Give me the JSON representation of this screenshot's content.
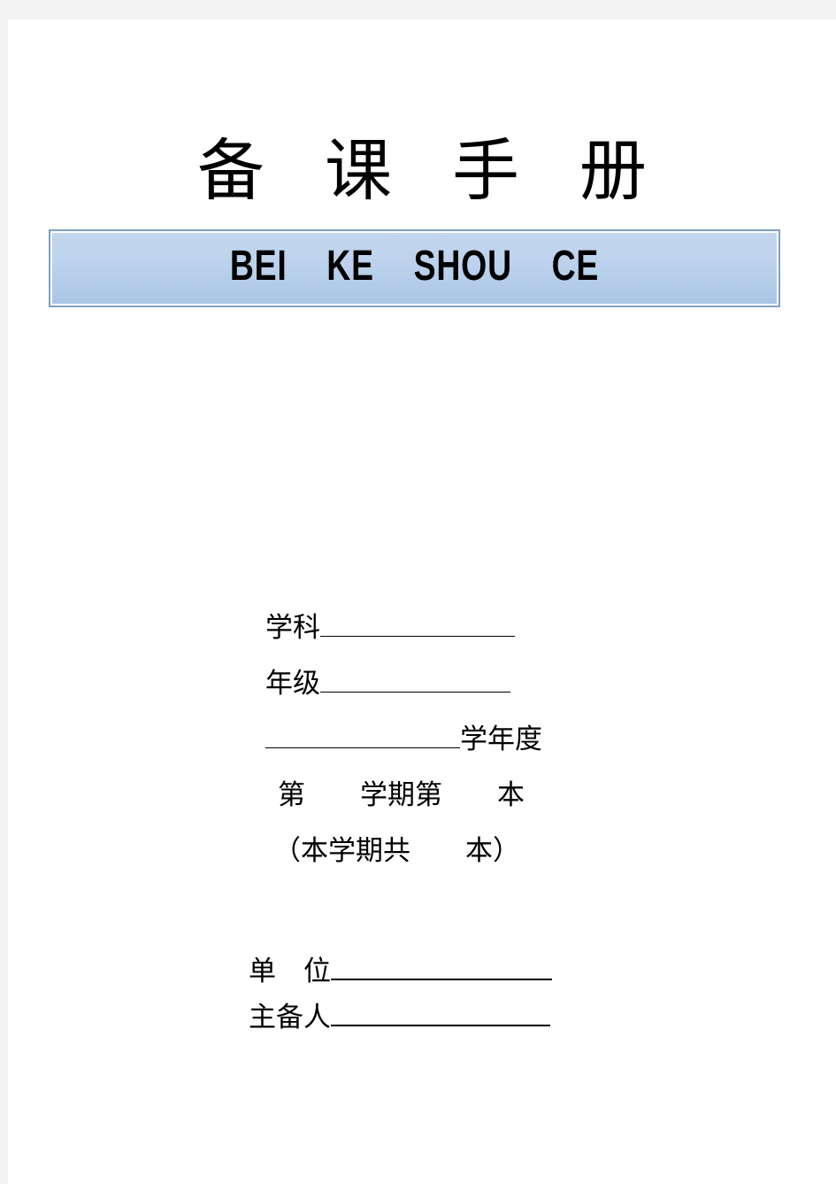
{
  "document": {
    "title_characters": [
      "备",
      "课",
      "手",
      "册"
    ],
    "banner_text": "BEI    KE    SHOU    CE",
    "banner_border_color": "#7fa0c6",
    "banner_fill_top_color": "#c4d7ef",
    "banner_fill_bottom_color": "#a9c5e5",
    "page_background_color": "#ffffff",
    "canvas_background_color": "#f4f4f4"
  },
  "form": {
    "subject": {
      "label": "学科",
      "value": ""
    },
    "grade": {
      "label": "年级",
      "value": ""
    },
    "school_year": {
      "value": "",
      "label": "学年度"
    },
    "term": {
      "label_before": "第",
      "label_middle": "　学期第",
      "label_after": "　本",
      "term_value": "",
      "book_value": ""
    },
    "term_line": "第　　学期第　　本",
    "total_line": "（本学期共　　本）",
    "unit": {
      "label": "单　位",
      "value": ""
    },
    "author": {
      "label": "主备人",
      "value": ""
    }
  }
}
